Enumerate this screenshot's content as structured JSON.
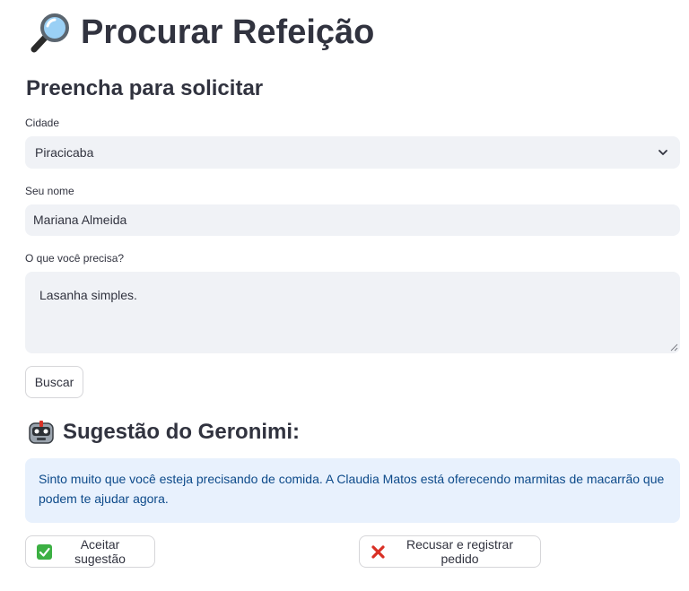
{
  "header": {
    "title": "Procurar Refeição",
    "icon": "magnifying-glass-icon"
  },
  "form": {
    "subtitle": "Preencha para solicitar",
    "city_label": "Cidade",
    "city_value": "Piracicaba",
    "name_label": "Seu nome",
    "name_value": "Mariana Almeida",
    "need_label": "O que você precisa?",
    "need_value": "Lasanha simples.",
    "search_button": "Buscar"
  },
  "suggestion": {
    "title": "Sugestão do Geronimi:",
    "icon": "robot-icon",
    "message": "Sinto muito que você esteja precisando de comida. A Claudia Matos está oferecendo marmitas de macarrão que podem te ajudar agora.",
    "accept_button": "Aceitar sugestão",
    "reject_button": "Recusar e registrar pedido"
  },
  "colors": {
    "accent_green": "#3cb043",
    "reject_red": "#d93025",
    "info_bg": "#e8f1fd",
    "info_text": "#0d4a8a",
    "field_bg": "#f0f2f6"
  }
}
